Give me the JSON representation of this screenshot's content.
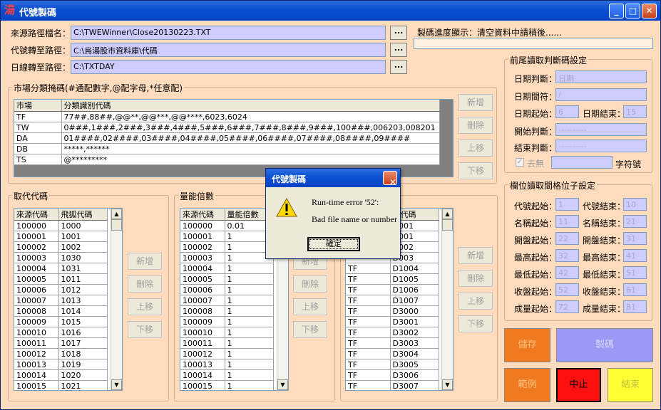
{
  "window": {
    "title": "代號製碼",
    "app_icon": "湯"
  },
  "paths": {
    "source_label": "來源路徑檔名：",
    "source_value": "C:\\TWEWinner\\Close20130223.TXT",
    "code_label": "代號轉至路徑：",
    "code_value": "C:\\烏湯股市資料庫\\代碼",
    "daily_label": "日線轉至路徑：",
    "daily_value": "C:\\TXTDAY",
    "browse_label": "..."
  },
  "progress": {
    "label": "製碼進度顯示：清空資料中請稍後......"
  },
  "market_group": {
    "title": "市場分類掩碼(#通配數字,@配字母,*任意配)",
    "columns": [
      "市場",
      "分類識別代碼"
    ],
    "rows": [
      [
        "TF",
        "77##,88##,@@**,@@***,@@****,6023,6024"
      ],
      [
        "TW",
        "0###,1###,2###,3###,4###,5###,6###,7###,8###,9###,100###,006203,008201"
      ],
      [
        "DA",
        "01####,02####,03####,04####,05####,06####,07####,08####,09####"
      ],
      [
        "DB",
        "*****,******"
      ],
      [
        "TS",
        "@*********"
      ]
    ]
  },
  "buttons": {
    "add": "新增",
    "delete": "刪除",
    "up": "上移",
    "down": "下移"
  },
  "replace_group": {
    "title": "取代代碼",
    "columns": [
      "來源代碼",
      "飛狐代碼"
    ],
    "rows": [
      [
        "100000",
        "1000"
      ],
      [
        "100001",
        "1001"
      ],
      [
        "100002",
        "1002"
      ],
      [
        "100003",
        "1030"
      ],
      [
        "100004",
        "1031"
      ],
      [
        "100005",
        "1011"
      ],
      [
        "100006",
        "1012"
      ],
      [
        "100007",
        "1013"
      ],
      [
        "100008",
        "1014"
      ],
      [
        "100009",
        "1015"
      ],
      [
        "100010",
        "1016"
      ],
      [
        "100011",
        "1017"
      ],
      [
        "100012",
        "1018"
      ],
      [
        "100013",
        "1019"
      ],
      [
        "100014",
        "1020"
      ],
      [
        "100015",
        "1021"
      ]
    ]
  },
  "volume_group": {
    "title": "量能倍數",
    "columns": [
      "來源代碼",
      "量能倍數"
    ],
    "rows": [
      [
        "100000",
        "0.01"
      ],
      [
        "100001",
        "1"
      ],
      [
        "100002",
        "1"
      ],
      [
        "100003",
        "1"
      ],
      [
        "100004",
        "1"
      ],
      [
        "100005",
        "1"
      ],
      [
        "100006",
        "1"
      ],
      [
        "100007",
        "1"
      ],
      [
        "100008",
        "1"
      ],
      [
        "100009",
        "1"
      ],
      [
        "100010",
        "1"
      ],
      [
        "100011",
        "1"
      ],
      [
        "100012",
        "1"
      ],
      [
        "100013",
        "1"
      ],
      [
        "100014",
        "1"
      ],
      [
        "100015",
        "1"
      ]
    ]
  },
  "stock_group": {
    "title": "",
    "columns": [
      "",
      "票代碼"
    ],
    "rows": [
      [
        "",
        "D001"
      ],
      [
        "",
        "D001"
      ],
      [
        "",
        "D002"
      ],
      [
        "",
        "D003"
      ],
      [
        "TF",
        "D1004"
      ],
      [
        "TF",
        "D1005"
      ],
      [
        "TF",
        "D1006"
      ],
      [
        "TF",
        "D1007"
      ],
      [
        "TF",
        "D3000"
      ],
      [
        "TF",
        "D3001"
      ],
      [
        "TF",
        "D3002"
      ],
      [
        "TF",
        "D3003"
      ],
      [
        "TF",
        "D3004"
      ],
      [
        "TF",
        "D3005"
      ],
      [
        "TF",
        "D3006"
      ],
      [
        "TF",
        "D3007"
      ]
    ]
  },
  "head_tail_group": {
    "title": "前尾讀取判斷碼設定",
    "date_check_label": "日期判斷：",
    "date_check_value": "日期",
    "date_sep_label": "日期間符：",
    "date_sep_value": "/",
    "date_start_label": "日期起始：",
    "date_start_value": "6",
    "date_end_label": "日期結束：",
    "date_end_value": "15",
    "begin_check_label": "開始判斷：",
    "begin_check_value": "----------",
    "end_check_label": "結束判斷：",
    "end_check_value": "----------",
    "remove_label": "去無",
    "char_label": "字符號"
  },
  "field_group": {
    "title": "欄位讀取間格位子設定",
    "items": [
      {
        "l1": "代號起始：",
        "v1": "1",
        "l2": "代號結束：",
        "v2": "10"
      },
      {
        "l1": "名稱起始：",
        "v1": "11",
        "l2": "名稱結束：",
        "v2": "21"
      },
      {
        "l1": "開盤起始：",
        "v1": "22",
        "l2": "開盤結束：",
        "v2": "31"
      },
      {
        "l1": "最高起始：",
        "v1": "32",
        "l2": "最高結束：",
        "v2": "41"
      },
      {
        "l1": "最低起始：",
        "v1": "42",
        "l2": "最低結束：",
        "v2": "51"
      },
      {
        "l1": "收盤起始：",
        "v1": "52",
        "l2": "收盤結束：",
        "v2": "61"
      },
      {
        "l1": "成量起始：",
        "v1": "72",
        "l2": "成量結束：",
        "v2": "81"
      }
    ]
  },
  "actions": {
    "save": "儲存",
    "make": "製碼",
    "example": "範例",
    "stop": "中止",
    "exit": "結束"
  },
  "colors": {
    "save": "#f07a20",
    "make": "#9a9af5",
    "example": "#f07a20",
    "stop": "#ff1010",
    "exit": "#ffff33"
  },
  "dialog": {
    "title": "代號製碼",
    "line1": "Run-time error '52':",
    "line2": "Bad file name or number",
    "ok": "確定",
    "icon": "warning-icon"
  }
}
